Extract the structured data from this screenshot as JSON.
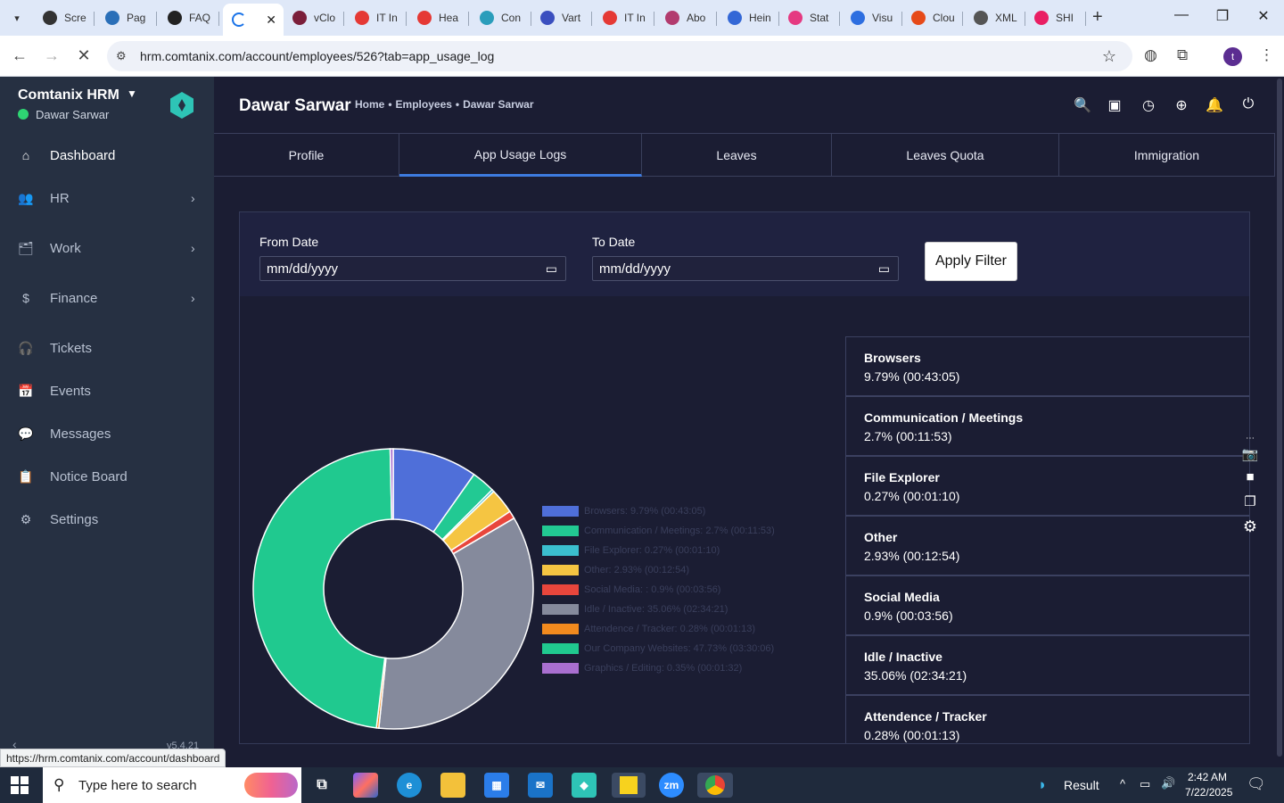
{
  "browser": {
    "tabs": [
      {
        "label": "Scre",
        "color": "#333333"
      },
      {
        "label": "Pag",
        "color": "#2a6fb8"
      },
      {
        "label": "FAQ",
        "color": "#222222"
      },
      {
        "label": "",
        "color": "#1a73e8",
        "active": true
      },
      {
        "label": "vClo",
        "color": "#7b1e3a"
      },
      {
        "label": "IT In",
        "color": "#e53935"
      },
      {
        "label": "Hea",
        "color": "#e53935"
      },
      {
        "label": "Con",
        "color": "#2a9dbb"
      },
      {
        "label": "Vart",
        "color": "#3b4fbf"
      },
      {
        "label": "IT In",
        "color": "#e53935"
      },
      {
        "label": "Abo",
        "color": "#b23b6e"
      },
      {
        "label": "Hein",
        "color": "#3367d6"
      },
      {
        "label": "Stat",
        "color": "#e53981"
      },
      {
        "label": "Visu",
        "color": "#2d6ee0"
      },
      {
        "label": "Clou",
        "color": "#e64a19"
      },
      {
        "label": "XML",
        "color": "#555555"
      },
      {
        "label": "SHI",
        "color": "#e91e63"
      }
    ],
    "url": "hrm.comtanix.com/account/employees/526?tab=app_usage_log",
    "profile_initial": "t",
    "status_url": "https://hrm.comtanix.com/account/dashboard"
  },
  "sidebar": {
    "brand": "Comtanix HRM",
    "user": "Dawar Sarwar",
    "items": [
      {
        "label": "Dashboard",
        "icon": "home-icon",
        "glyph": "⌂",
        "chevron": false,
        "active": true
      },
      {
        "label": "HR",
        "icon": "users-icon",
        "glyph": "👥",
        "chevron": true
      },
      {
        "label": "Work",
        "icon": "briefcase-icon",
        "glyph": "🗂",
        "chevron": true
      },
      {
        "label": "Finance",
        "icon": "dollar-icon",
        "glyph": "$",
        "chevron": true
      },
      {
        "label": "Tickets",
        "icon": "headset-icon",
        "glyph": "🎧",
        "chevron": false
      },
      {
        "label": "Events",
        "icon": "calendar-icon",
        "glyph": "📅",
        "chevron": false
      },
      {
        "label": "Messages",
        "icon": "message-icon",
        "glyph": "💬",
        "chevron": false
      },
      {
        "label": "Notice Board",
        "icon": "clipboard-icon",
        "glyph": "📋",
        "chevron": false
      },
      {
        "label": "Settings",
        "icon": "gear-icon",
        "glyph": "⚙",
        "chevron": false
      }
    ],
    "version": "v5.4.21"
  },
  "header": {
    "title": "Dawar Sarwar",
    "breadcrumbs": [
      "Home",
      "•",
      "Employees",
      "•",
      "Dawar Sarwar"
    ]
  },
  "profile_tabs": [
    {
      "label": "Profile"
    },
    {
      "label": "App Usage Logs",
      "active": true
    },
    {
      "label": "Leaves"
    },
    {
      "label": "Leaves Quota"
    },
    {
      "label": "Immigration"
    }
  ],
  "filter": {
    "from_label": "From Date",
    "from_placeholder": "mm/dd/yyyy",
    "to_label": "To Date",
    "to_placeholder": "mm/dd/yyyy",
    "apply_label": "Apply Filter"
  },
  "chart_data": {
    "type": "pie",
    "categories": [
      "Browsers",
      "Communication / Meetings",
      "File Explorer",
      "Other",
      "Social Media",
      "Idle / Inactive",
      "Attendence / Tracker",
      "Our Company Websites",
      "Graphics / Editing"
    ],
    "values": [
      9.79,
      2.7,
      0.27,
      2.93,
      0.9,
      35.06,
      0.28,
      47.73,
      0.35
    ],
    "legend_labels": [
      "Browsers: 9.79% (00:43:05)",
      "Communication / Meetings: 2.7% (00:11:53)",
      "File Explorer: 0.27% (00:01:10)",
      "Other: 2.93% (00:12:54)",
      "Social Media: : 0.9% (00:03:56)",
      "Idle / Inactive: 35.06% (02:34:21)",
      "Attendence / Tracker: 0.28% (00:01:13)",
      "Our Company Websites: 47.73% (03:30:06)",
      "Graphics / Editing: 0.35% (00:01:32)"
    ],
    "colors": [
      "#4f6fd9",
      "#22c993",
      "#3bbfcf",
      "#f5c542",
      "#e8463c",
      "#858a9c",
      "#f28a1e",
      "#20c98f",
      "#a96fd0"
    ],
    "legend_placement": "right"
  },
  "category_list": [
    {
      "name": "Browsers",
      "value": "9.79% (00:43:05)"
    },
    {
      "name": "Communication / Meetings",
      "value": "2.7% (00:11:53)"
    },
    {
      "name": "File Explorer",
      "value": "0.27% (00:01:10)"
    },
    {
      "name": "Other",
      "value": "2.93% (00:12:54)"
    },
    {
      "name": "Social Media",
      "value": "0.9% (00:03:56)"
    },
    {
      "name": "Idle / Inactive",
      "value": "35.06% (02:34:21)"
    },
    {
      "name": "Attendence / Tracker",
      "value": "0.28% (00:01:13)"
    }
  ],
  "taskbar": {
    "search_placeholder": "Type here to search",
    "weather": "Result",
    "time": "2:42 AM",
    "date": "7/22/2025"
  }
}
